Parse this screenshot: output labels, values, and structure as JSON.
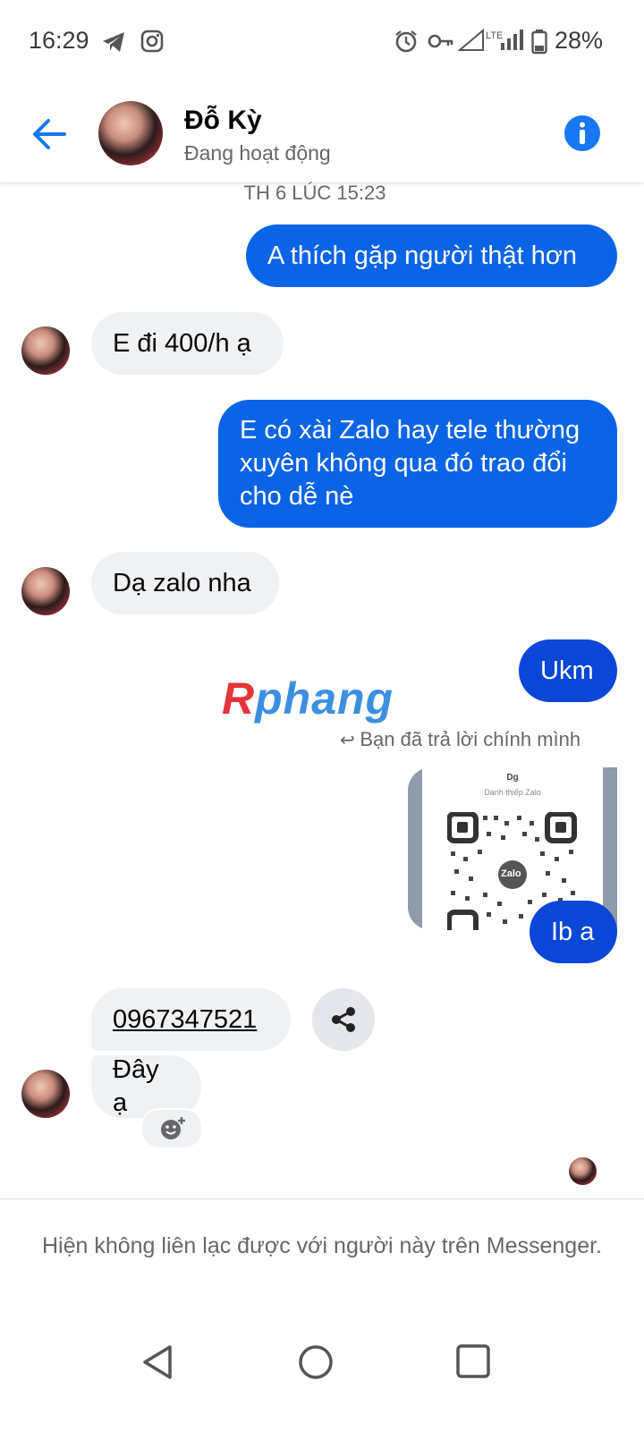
{
  "status_bar": {
    "time": "16:29",
    "network": "LTE",
    "battery": "28%"
  },
  "header": {
    "contact_name": "Đỗ Kỳ",
    "presence": "Đang hoạt động",
    "back_icon": "arrow-left-icon",
    "info_icon": "info-icon",
    "accent": "#1877f2"
  },
  "thread": {
    "timestamp": "TH 6 LÚC 15:23",
    "messages": [
      {
        "from": "me",
        "text": "A thích gặp người thật hơn"
      },
      {
        "from": "them",
        "text": "E đi 400/h ạ"
      },
      {
        "from": "me",
        "text": "E có xài Zalo hay tele thường xuyên không qua đó trao đổi cho dễ nè"
      },
      {
        "from": "them",
        "text": "Dạ zalo nha"
      },
      {
        "from": "me",
        "text": "Ukm"
      },
      {
        "from": "me",
        "text": "Ib a"
      },
      {
        "from": "them",
        "text": "0967347521"
      },
      {
        "from": "them",
        "text": "Đây ạ"
      }
    ],
    "reply_note": "Bạn đã trả lời chính mình",
    "qr_card": {
      "title": "Dg",
      "subtitle": "Danh thiếp Zalo",
      "logo_text": "Zalo"
    },
    "watermark": "Rphang"
  },
  "notice": "Hiện không liên lạc được với người này trên Messenger.",
  "colors": {
    "outgoing": "#0a64e6",
    "incoming": "#f0f1f2",
    "accent": "#1877f2"
  }
}
